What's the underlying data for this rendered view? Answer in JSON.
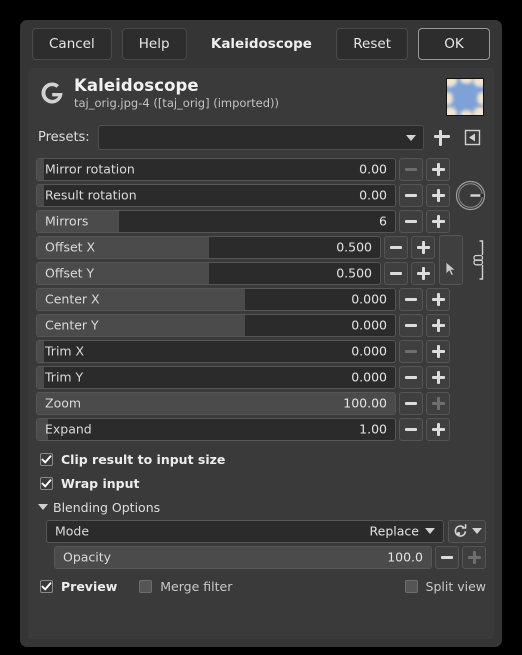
{
  "titlebar": {
    "cancel": "Cancel",
    "help": "Help",
    "title": "Kaleidoscope",
    "reset": "Reset",
    "ok": "OK"
  },
  "operation": {
    "name": "Kaleidoscope",
    "subtitle": "taj_orig.jpg-4 ([taj_orig] (imported))",
    "icon": "gegl-g-icon",
    "thumbnail": "kaleidoscope-preview-thumbnail"
  },
  "presets": {
    "label": "Presets:",
    "value": "",
    "add_icon": "plus-icon",
    "menu_icon": "preset-menu-icon"
  },
  "parameters": [
    {
      "label": "Mirror rotation",
      "value": "0.00",
      "fill_pct": 2,
      "minus_enabled": false,
      "plus_enabled": true,
      "widget": "dial_none"
    },
    {
      "label": "Result rotation",
      "value": "0.00",
      "fill_pct": 2,
      "minus_enabled": true,
      "plus_enabled": true,
      "widget": "angle_dial"
    },
    {
      "label": "Mirrors",
      "value": "6",
      "fill_pct": 23,
      "minus_enabled": true,
      "plus_enabled": true,
      "widget": "none"
    },
    {
      "label": "Offset X",
      "value": "0.500",
      "fill_pct": 50,
      "minus_enabled": true,
      "plus_enabled": true,
      "widget": "pick_chain"
    },
    {
      "label": "Offset Y",
      "value": "0.500",
      "fill_pct": 50,
      "minus_enabled": true,
      "plus_enabled": true,
      "widget": "pick_chain"
    },
    {
      "label": "Center X",
      "value": "0.000",
      "fill_pct": 58,
      "minus_enabled": true,
      "plus_enabled": true,
      "widget": "none"
    },
    {
      "label": "Center Y",
      "value": "0.000",
      "fill_pct": 58,
      "minus_enabled": true,
      "plus_enabled": true,
      "widget": "none"
    },
    {
      "label": "Trim X",
      "value": "0.000",
      "fill_pct": 2,
      "minus_enabled": false,
      "plus_enabled": true,
      "widget": "none"
    },
    {
      "label": "Trim Y",
      "value": "0.000",
      "fill_pct": 2,
      "minus_enabled": false,
      "plus_enabled": true,
      "widget": "none"
    },
    {
      "label": "Zoom",
      "value": "100.00",
      "fill_pct": 100,
      "minus_enabled": true,
      "plus_enabled": false,
      "widget": "none"
    },
    {
      "label": "Expand",
      "value": "1.00",
      "fill_pct": 3,
      "minus_enabled": true,
      "plus_enabled": true,
      "widget": "none"
    }
  ],
  "checkboxes": {
    "clip_result": {
      "label": "Clip result to input size",
      "checked": true
    },
    "wrap_input": {
      "label": "Wrap input",
      "checked": true
    }
  },
  "blending": {
    "title": "Blending Options",
    "expanded": true,
    "mode_label": "Mode",
    "mode_value": "Replace",
    "mode_switch_icon": "blend-switch-icon",
    "opacity_label": "Opacity",
    "opacity_value": "100.0",
    "opacity_fill_pct": 100,
    "opacity_minus_enabled": true,
    "opacity_plus_enabled": false
  },
  "footer": {
    "preview": {
      "label": "Preview",
      "checked": true
    },
    "merge_filter": {
      "label": "Merge filter",
      "checked": false
    },
    "split_view": {
      "label": "Split view",
      "checked": false
    }
  },
  "colors": {
    "window_bg": "#353535",
    "panel_bg": "#3a3a3a",
    "trough": "#2b2b2b",
    "fill": "#4b4b4b",
    "text": "#dadada",
    "thumb_sky": "#7ea2d8",
    "thumb_blob": "#f2e4cd"
  }
}
